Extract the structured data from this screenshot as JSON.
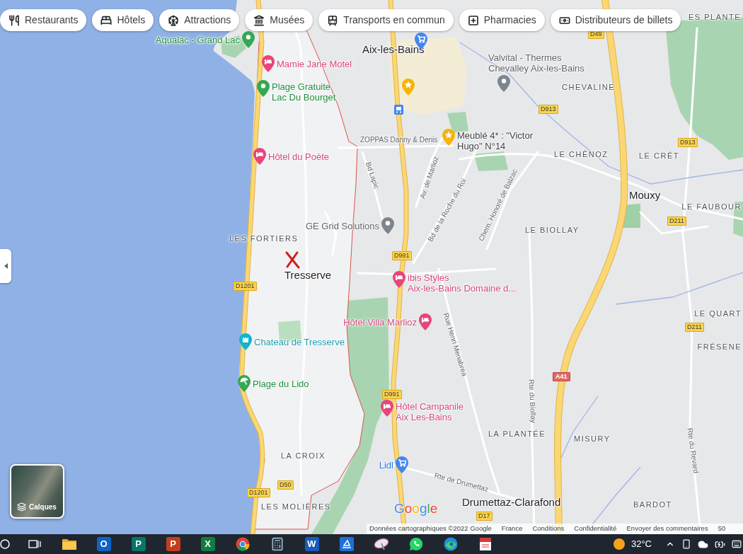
{
  "category_chips": [
    "Restaurants",
    "Hôtels",
    "Attractions",
    "Musées",
    "Transports en commun",
    "Pharmacies",
    "Distributeurs de billets"
  ],
  "map_labels": [
    {
      "kind": "district",
      "text": "ES PLANTE"
    },
    {
      "kind": "park",
      "text": "Aqualac - Grand Lac"
    },
    {
      "kind": "road",
      "text": "D49"
    },
    {
      "kind": "town",
      "text": "Aix-les-Bains"
    },
    {
      "kind": "hotel",
      "text": "Mamie Jane Motel"
    },
    {
      "kind": "place",
      "lines": [
        "Valvital - Thermes",
        "Chevalley Aix-les-Bains"
      ]
    },
    {
      "kind": "park",
      "lines": [
        "Plage Gratuite",
        "Lac Du Bourget"
      ]
    },
    {
      "kind": "district",
      "text": "CHEVALINE"
    },
    {
      "kind": "road",
      "text": "D913"
    },
    {
      "kind": "street",
      "text": "ZOPPAS Danny & Denis"
    },
    {
      "kind": "attraction",
      "lines": [
        "Meublé 4* : \"Victor",
        "Hugo\" N°14"
      ]
    },
    {
      "kind": "road",
      "text": "D913"
    },
    {
      "kind": "hotel",
      "text": "Hôtel du Poète"
    },
    {
      "kind": "district",
      "text": "LE CHÊNOZ"
    },
    {
      "kind": "district",
      "text": "LE CRÊT"
    },
    {
      "kind": "street",
      "text": "Bd Lapic"
    },
    {
      "kind": "street",
      "text": "Av. de Marlioz"
    },
    {
      "kind": "street",
      "text": "Bd de la Roche du Roi"
    },
    {
      "kind": "street",
      "text": "Chem. Honoré de Balzac"
    },
    {
      "kind": "town",
      "text": "Mouxy"
    },
    {
      "kind": "district",
      "text": "LE FAUBOUR"
    },
    {
      "kind": "place",
      "text": "GE Grid Solutions"
    },
    {
      "kind": "road",
      "text": "D211"
    },
    {
      "kind": "district",
      "text": "LES FORTIERS"
    },
    {
      "kind": "district",
      "text": "LE BIOLLAY"
    },
    {
      "kind": "road",
      "text": "D991"
    },
    {
      "kind": "road",
      "text": "D1201"
    },
    {
      "kind": "town",
      "text": "Tresserve"
    },
    {
      "kind": "hotel",
      "lines": [
        "ibis Styles",
        "Aix-les-Bains Domaine d..."
      ]
    },
    {
      "kind": "hotel",
      "text": "Hôtel Villa Marlioz"
    },
    {
      "kind": "landmark",
      "text": "Chateau de Tresserve"
    },
    {
      "kind": "street",
      "text": "Rue Henri Menabrea"
    },
    {
      "kind": "district",
      "text": "LE QUART"
    },
    {
      "kind": "road",
      "text": "D211"
    },
    {
      "kind": "district",
      "text": "FRÉSENE"
    },
    {
      "kind": "beach",
      "text": "Plage du Lido"
    },
    {
      "kind": "motorway",
      "text": "A41"
    },
    {
      "kind": "road",
      "text": "D991"
    },
    {
      "kind": "hotel",
      "lines": [
        "Hôtel Campanile",
        "Aix Les-Bains"
      ]
    },
    {
      "kind": "street",
      "text": "Rte du Biollay"
    },
    {
      "kind": "district",
      "text": "LA PLANTÉE"
    },
    {
      "kind": "district",
      "text": "MISURY"
    },
    {
      "kind": "district",
      "text": "LA CROIX"
    },
    {
      "kind": "shop",
      "text": "Lidl"
    },
    {
      "kind": "street",
      "text": "Rte du Revard"
    },
    {
      "kind": "road",
      "text": "D1201"
    },
    {
      "kind": "road",
      "text": "D50"
    },
    {
      "kind": "street",
      "text": "Rte de Drumettaz"
    },
    {
      "kind": "district",
      "text": "LES MOLIÈRES"
    },
    {
      "kind": "town",
      "text": "Drumettaz-Clarafond"
    },
    {
      "kind": "district",
      "text": "BARDOT"
    },
    {
      "kind": "road",
      "text": "D17"
    }
  ],
  "map_logo": "Google",
  "layers_button": "Calques",
  "attribution": [
    "Données cartographiques ©2022 Google",
    "France",
    "Conditions",
    "Confidentialité",
    "Envoyer des commentaires",
    "50"
  ],
  "taskbar": {
    "apps": [
      {
        "kind": "search"
      },
      {
        "kind": "task_view"
      },
      {
        "kind": "folder"
      },
      {
        "kind": "mail",
        "glyph": "O"
      },
      {
        "kind": "publisher",
        "glyph": "P"
      },
      {
        "kind": "slides",
        "glyph": "P"
      },
      {
        "kind": "sheet",
        "glyph": "X"
      },
      {
        "kind": "browser"
      },
      {
        "kind": "calculator"
      },
      {
        "kind": "doc",
        "glyph": "W"
      },
      {
        "kind": "scanner"
      },
      {
        "kind": "satellite"
      },
      {
        "kind": "chat"
      },
      {
        "kind": "web"
      },
      {
        "kind": "document"
      }
    ],
    "temperature": "32°C"
  }
}
